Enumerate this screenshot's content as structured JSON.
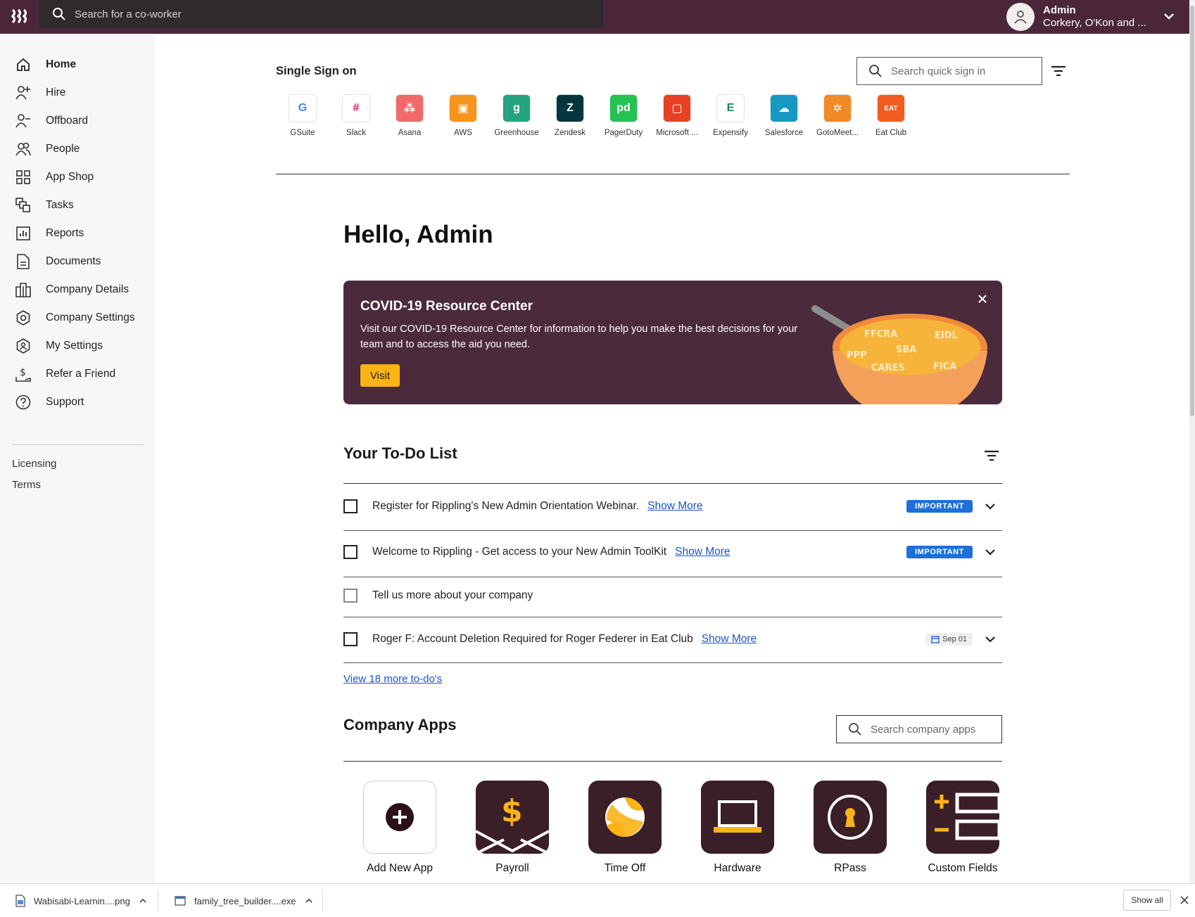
{
  "header": {
    "logo_text": "⦀",
    "search_placeholder": "Search for a co-worker",
    "account_name": "Admin",
    "account_company": "Corkery, O'Kon and ..."
  },
  "sidebar": {
    "items": [
      {
        "label": "Home",
        "icon": "home-icon"
      },
      {
        "label": "Hire",
        "icon": "add-person-icon"
      },
      {
        "label": "Offboard",
        "icon": "remove-person-icon"
      },
      {
        "label": "People",
        "icon": "people-icon"
      },
      {
        "label": "App Shop",
        "icon": "grid-icon"
      },
      {
        "label": "Tasks",
        "icon": "tasks-icon"
      },
      {
        "label": "Reports",
        "icon": "reports-icon"
      },
      {
        "label": "Documents",
        "icon": "document-icon"
      },
      {
        "label": "Company Details",
        "icon": "building-icon"
      },
      {
        "label": "Company Settings",
        "icon": "gear-icon"
      },
      {
        "label": "My Settings",
        "icon": "user-gear-icon"
      },
      {
        "label": "Refer a Friend",
        "icon": "dollar-hand-icon"
      },
      {
        "label": "Support",
        "icon": "help-icon"
      }
    ],
    "links": [
      "Licensing",
      "Terms"
    ]
  },
  "sso": {
    "title": "Single Sign on",
    "search_placeholder": "Search quick sign in",
    "apps": [
      {
        "label": "GSuite",
        "tile": "G",
        "bg": "#ffffff",
        "fg": "#4285f4"
      },
      {
        "label": "Slack",
        "tile": "#",
        "bg": "#ffffff",
        "fg": "#e01e5a"
      },
      {
        "label": "Asana",
        "tile": "⁂",
        "bg": "#f06a6a",
        "fg": "#ffffff"
      },
      {
        "label": "AWS",
        "tile": "▣",
        "bg": "#f7941d",
        "fg": "#ffffff"
      },
      {
        "label": "Greenhouse",
        "tile": "g",
        "bg": "#24a47f",
        "fg": "#ffffff"
      },
      {
        "label": "Zendesk",
        "tile": "Z",
        "bg": "#03363d",
        "fg": "#ffffff"
      },
      {
        "label": "PagerDuty",
        "tile": "pd",
        "bg": "#25c151",
        "fg": "#ffffff"
      },
      {
        "label": "Microsoft ...",
        "tile": "▢",
        "bg": "#e74025",
        "fg": "#ffffff"
      },
      {
        "label": "Expensify",
        "tile": "E",
        "bg": "#ffffff",
        "fg": "#0e8a4e"
      },
      {
        "label": "Salesforce",
        "tile": "☁",
        "bg": "#1798c1",
        "fg": "#ffffff"
      },
      {
        "label": "GotoMeet...",
        "tile": "✲",
        "bg": "#f08a24",
        "fg": "#ffffff"
      },
      {
        "label": "Eat Club",
        "tile": "EAT",
        "bg": "#f25c1f",
        "fg": "#ffffff"
      }
    ]
  },
  "greeting": "Hello, Admin",
  "covid": {
    "title": "COVID-19 Resource Center",
    "body": "Visit our COVID-19 Resource Center for information to help you make the best decisions for your team and to access the aid you need.",
    "button": "Visit",
    "soup_letters": [
      "FFCRA",
      "EIDL",
      "SBA",
      "PPP",
      "CARES",
      "FICA"
    ]
  },
  "todo": {
    "title": "Your To-Do List",
    "items": [
      {
        "text": "Register for Rippling's New Admin Orientation Webinar.",
        "link": "Show More",
        "badge": "IMPORTANT"
      },
      {
        "text": "Welcome to Rippling - Get access to your New Admin ToolKit",
        "link": "Show More",
        "badge": "IMPORTANT"
      },
      {
        "text": "Tell us more about your company"
      },
      {
        "text": "Roger F: Account Deletion Required for Roger Federer in Eat Club",
        "link": "Show More",
        "date": "Sep 01"
      }
    ],
    "view_more": "View 18 more to-do's"
  },
  "company_apps": {
    "title": "Company Apps",
    "search_placeholder": "Search company apps",
    "apps": [
      {
        "label": "Add New App",
        "icon": "add-circle-icon"
      },
      {
        "label": "Payroll",
        "icon": "payroll-icon"
      },
      {
        "label": "Time Off",
        "icon": "beach-ball-icon"
      },
      {
        "label": "Hardware",
        "icon": "laptop-icon"
      },
      {
        "label": "RPass",
        "icon": "keyhole-icon"
      },
      {
        "label": "Custom Fields",
        "icon": "custom-fields-icon"
      }
    ]
  },
  "downloads": {
    "items": [
      "Wabisabi-Learnin....png",
      "family_tree_builder....exe"
    ],
    "show_all": "Show all"
  },
  "colors": {
    "brand": "#4a2638",
    "accent_yellow": "#fbb316",
    "link_blue": "#1a55c8",
    "badge_blue": "#1f6fd8"
  }
}
